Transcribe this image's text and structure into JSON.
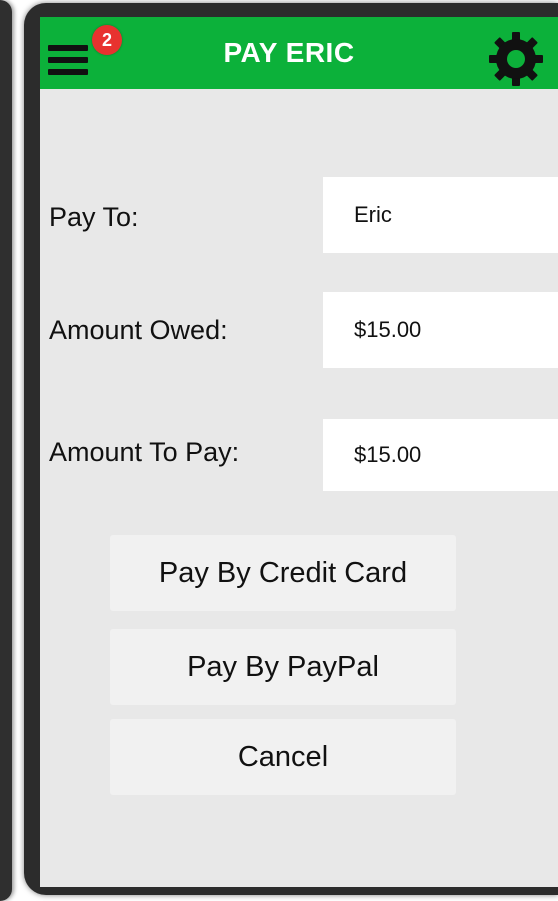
{
  "header": {
    "title": "PAY ERIC",
    "notification_count": "2",
    "menu_icon": "hamburger-menu-icon",
    "settings_icon": "gear-icon",
    "accent_color": "#0cb13a",
    "badge_color": "#e8322f"
  },
  "form": {
    "pay_to": {
      "label": "Pay To:",
      "value": "Eric"
    },
    "amount_owed": {
      "label": "Amount Owed:",
      "value": "$15.00"
    },
    "amount_to_pay": {
      "label": "Amount To Pay:",
      "value": "$15.00"
    }
  },
  "actions": {
    "credit_card_label": "Pay By Credit Card",
    "paypal_label": "Pay By PayPal",
    "cancel_label": "Cancel"
  }
}
